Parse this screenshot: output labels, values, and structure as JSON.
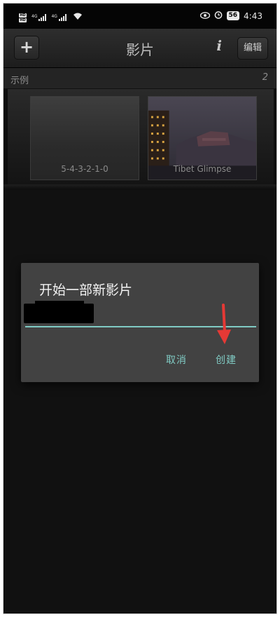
{
  "status_bar": {
    "sim1_label_top": "HD",
    "sim1_label_bottom": "HD",
    "signal1_label": "4G",
    "signal2_label": "4G",
    "battery_level": "56",
    "time": "4:43",
    "icons": [
      "hd-icon",
      "signal-icon",
      "wifi-icon",
      "eye-icon",
      "alarm-icon",
      "battery-icon"
    ]
  },
  "toolbar": {
    "add_label": "+",
    "title": "影片",
    "info_label": "i",
    "edit_label": "编辑"
  },
  "section": {
    "label": "示例",
    "count": "2"
  },
  "movies": [
    {
      "caption": "5-4-3-2-1-0"
    },
    {
      "caption": "Tibet Glimpse"
    }
  ],
  "dialog": {
    "title": "开始一部新影片",
    "input_value": "",
    "cancel_label": "取消",
    "create_label": "创建"
  },
  "colors": {
    "accent": "#80cbc4",
    "arrow": "#e53935",
    "dialog_bg": "#424242",
    "app_bg": "#0d0d0d"
  }
}
